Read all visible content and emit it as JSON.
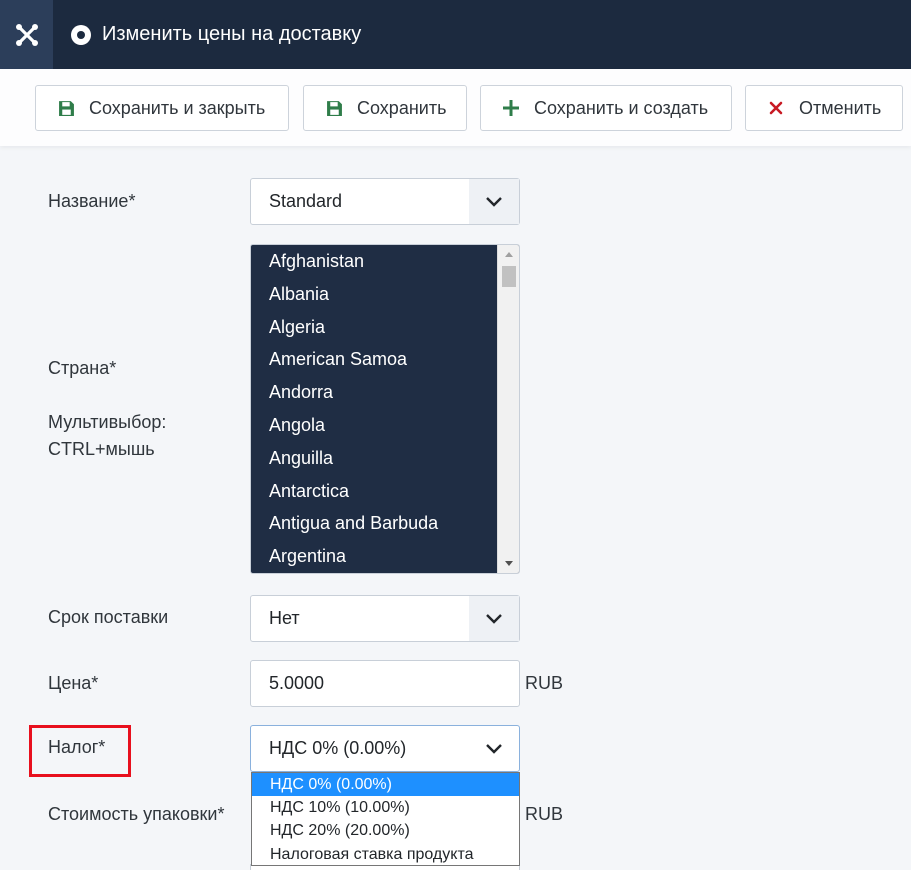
{
  "header": {
    "title": "Изменить цены на доставку",
    "logo_icon": "joomla-logo-icon",
    "bg_color": "#1c2a3f"
  },
  "toolbar": {
    "save_close": "Сохранить и закрыть",
    "save": "Сохранить",
    "save_new": "Сохранить и создать",
    "cancel": "Отменить"
  },
  "form": {
    "name_label": "Название*",
    "name_value": "Standard",
    "country_label": "Страна*",
    "multiselect_hint_1": "Мультивыбор:",
    "multiselect_hint_2": "CTRL+мышь",
    "countries": [
      "Afghanistan",
      "Albania",
      "Algeria",
      "American Samoa",
      "Andorra",
      "Angola",
      "Anguilla",
      "Antarctica",
      "Antigua and Barbuda",
      "Argentina"
    ],
    "delivery_label": "Срок поставки",
    "delivery_value": "Нет",
    "price_label": "Цена*",
    "price_value": "5.0000",
    "price_currency": "RUB",
    "tax_label": "Налог*",
    "tax_value": "НДС 0% (0.00%)",
    "tax_options": [
      "НДС 0% (0.00%)",
      "НДС 10% (10.00%)",
      "НДС 20% (20.00%)",
      "Налоговая ставка продукта"
    ],
    "package_label": "Стоимость упаковки*",
    "package_currency": "RUB"
  }
}
